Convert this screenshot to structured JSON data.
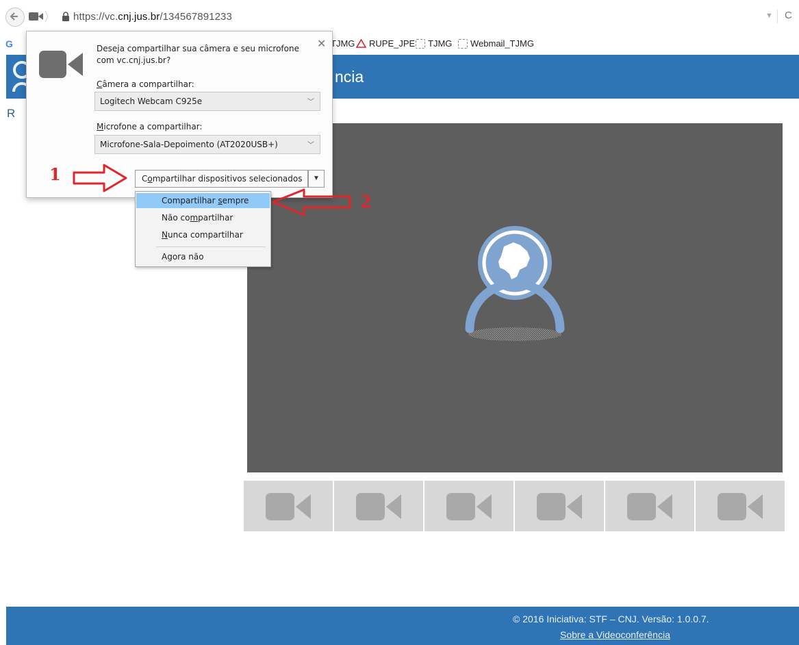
{
  "browser": {
    "url_prefix": "https://vc.",
    "url_domain": "cnj.jus.br",
    "url_path": "/134567891233",
    "bookmarks": [
      {
        "label": "G",
        "icon": "google-icon"
      },
      {
        "label": "TJMG",
        "icon": "none"
      },
      {
        "label": "RUPE_JPE",
        "icon": "warning-triangle-icon"
      },
      {
        "label": "TJMG",
        "icon": "dashed-page-icon"
      },
      {
        "label": "Webmail_TJMG",
        "icon": "dashed-page-icon"
      }
    ]
  },
  "app": {
    "header_title": "ncia",
    "room_label": "R",
    "footer_copyright": "© 2016 Iniciativa: STF – CNJ. Versão: 1.0.0.7.",
    "footer_link": "Sobre a Videoconferência"
  },
  "dialog": {
    "question": "Deseja compartilhar sua câmera e seu microfone com vc.cnj.jus.br?",
    "camera_label_first": "C",
    "camera_label_rest": "âmera a compartilhar:",
    "camera_value": "Logitech Webcam C925e",
    "mic_label_first": "M",
    "mic_label_rest": "icrofone a compartilhar:",
    "mic_value": "Microfone-Sala-Depoimento (AT2020USB+)",
    "share_button_a": "C",
    "share_button_b": "o",
    "share_button_c": "mpartilhar dispositivos selecionados"
  },
  "menu": {
    "items": [
      {
        "a": "Compartilhar ",
        "u": "s",
        "b": "empre"
      },
      {
        "a": "Não co",
        "u": "m",
        "b": "partilhar"
      },
      {
        "a": "",
        "u": "N",
        "b": "unca compartilhar"
      },
      {
        "a": "Agora não",
        "u": "",
        "b": ""
      }
    ]
  },
  "annotations": {
    "step1": "1",
    "step2": "2"
  },
  "colors": {
    "header": "#2f74b4",
    "video_bg": "#5f5e5f",
    "thumb_bg": "#d7d7d7",
    "highlight": "#91c9f7",
    "annotation": "#e0262b",
    "avatar": "#7fa4cf"
  }
}
